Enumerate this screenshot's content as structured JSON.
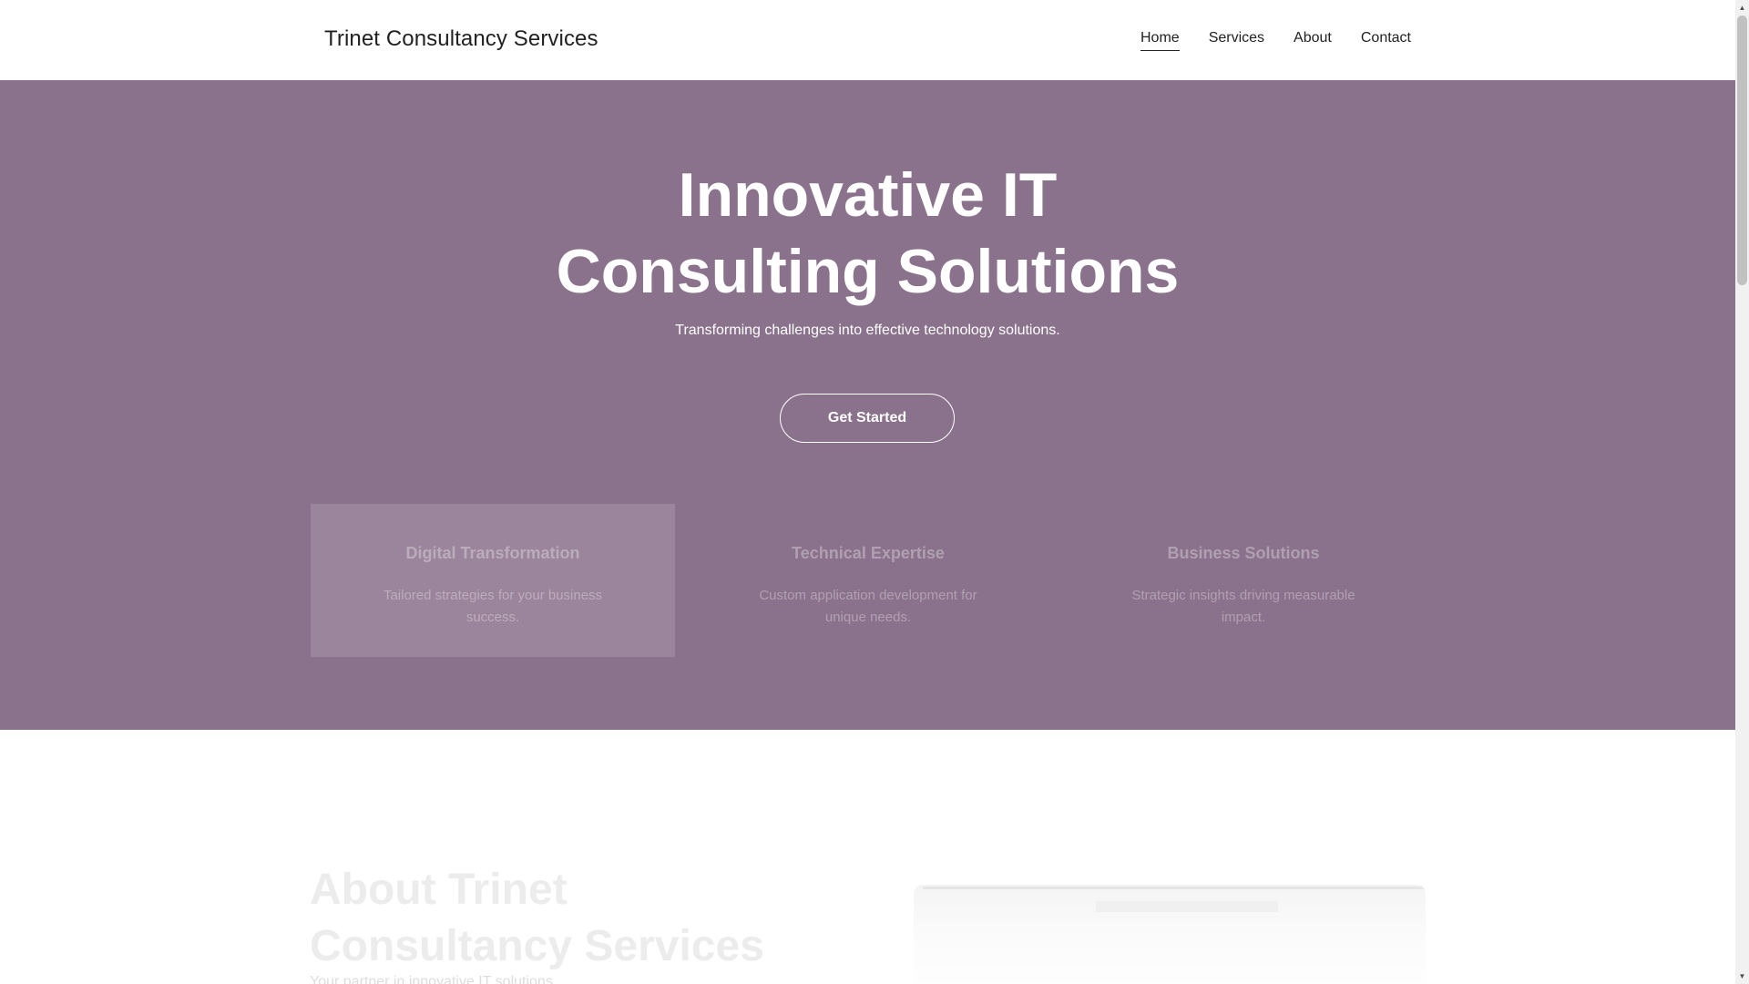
{
  "header": {
    "brand": "Trinet Consultancy Services",
    "nav": {
      "home": "Home",
      "services": "Services",
      "about": "About",
      "contact": "Contact"
    },
    "active_nav": "Home"
  },
  "hero": {
    "title": "Innovative IT Consulting Solutions",
    "subtitle": "Transforming challenges into effective technology solutions.",
    "cta_label": "Get Started",
    "background_color": "#8b728c",
    "features": [
      {
        "title": "Digital Transformation",
        "text": "Tailored strategies for your business success."
      },
      {
        "title": "Technical Expertise",
        "text": "Custom application development for unique needs."
      },
      {
        "title": "Business Solutions",
        "text": "Strategic insights driving measurable impact."
      }
    ]
  },
  "about": {
    "title": "About Trinet Consultancy Services",
    "tagline": "Your partner in innovative IT solutions."
  },
  "scrollbar": {
    "up_arrow": "▲",
    "down_arrow": "▼"
  }
}
